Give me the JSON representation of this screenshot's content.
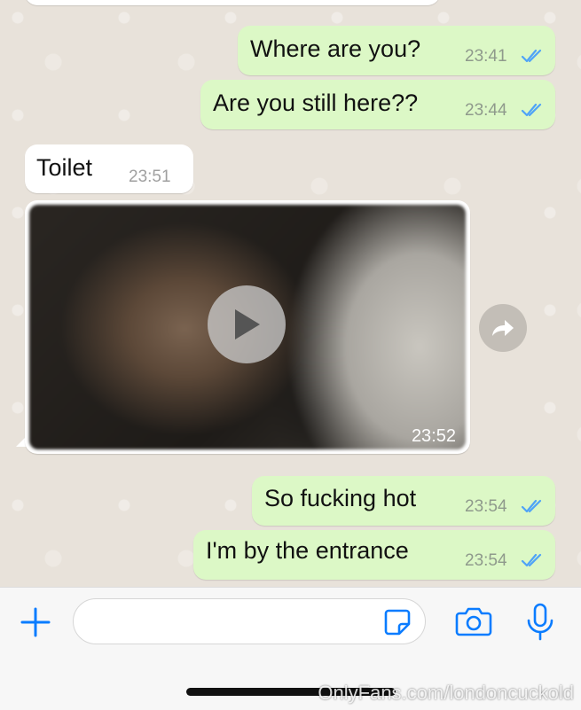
{
  "messages": [
    {
      "direction": "outgoing",
      "text": "Where are you?",
      "time": "23:41",
      "status": "read"
    },
    {
      "direction": "outgoing",
      "text": "Are you still here??",
      "time": "23:44",
      "status": "read"
    },
    {
      "direction": "incoming",
      "text": "Toilet",
      "time": "23:51"
    },
    {
      "direction": "incoming",
      "type": "video",
      "time": "23:52"
    },
    {
      "direction": "outgoing",
      "text": "So fucking hot",
      "time": "23:54",
      "status": "read"
    },
    {
      "direction": "outgoing",
      "text": "I'm by the entrance",
      "time": "23:54",
      "status": "read"
    }
  ],
  "input": {
    "placeholder": ""
  },
  "icons": {
    "attach": "plus-icon",
    "sticker": "sticker-icon",
    "camera": "camera-icon",
    "mic": "microphone-icon",
    "forward": "forward-icon",
    "play": "play-icon",
    "read_receipt": "double-check-icon"
  },
  "colors": {
    "outgoing_bubble": "#dcf8c6",
    "incoming_bubble": "#ffffff",
    "accent": "#0a7cff",
    "ticks": "#4fa3f7"
  },
  "watermark": "OnlyFans.com/londoncuckold"
}
